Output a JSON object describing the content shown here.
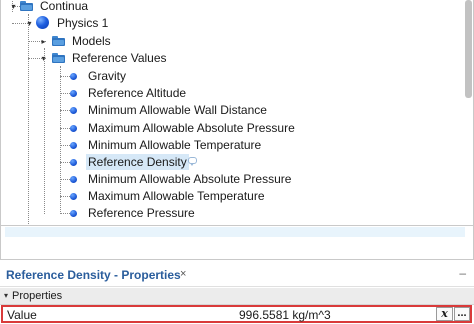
{
  "tree": {
    "continua": "Continua",
    "physics": "Physics 1",
    "models": "Models",
    "reference_values": "Reference Values",
    "items": [
      "Gravity",
      "Reference Altitude",
      "Minimum Allowable Wall Distance",
      "Maximum Allowable Absolute Pressure",
      "Minimum Allowable Temperature",
      "Reference Density",
      "Minimum Allowable Absolute Pressure",
      "Maximum Allowable Temperature",
      "Reference Pressure"
    ],
    "selected_item": "Reference Density"
  },
  "properties": {
    "title": "Reference Density - Properties",
    "close_glyph": "×",
    "minimize_glyph": "–",
    "section_label": "Properties",
    "section_arrow": "▾",
    "value_label": "Value",
    "value": "996.5581 kg/m^3",
    "expr_button": "x",
    "ellipsis_button": "..."
  },
  "colors": {
    "title_blue": "#2a5d9c",
    "selection": "#d6e8f7",
    "highlight_border": "#d93a3a",
    "icon_blue": "#1f5fe0"
  },
  "icons": {
    "folder": "folder-icon",
    "physics": "sphere-icon",
    "value_node": "dot-icon"
  }
}
